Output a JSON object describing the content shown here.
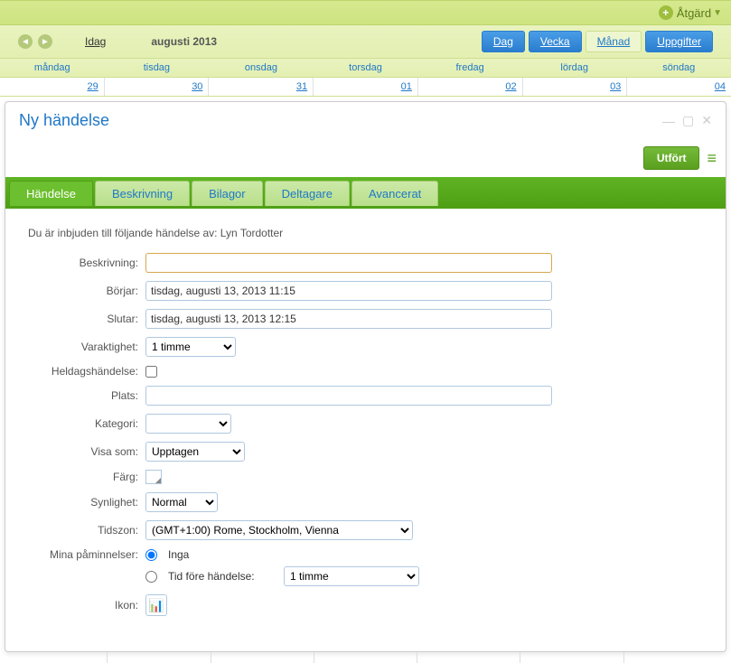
{
  "topbar": {
    "action_label": "Åtgärd"
  },
  "calendar": {
    "today_label": "Idag",
    "title": "augusti 2013",
    "views": {
      "day": "Dag",
      "week": "Vecka",
      "month": "Månad",
      "tasks": "Uppgifter"
    },
    "weekdays": [
      "måndag",
      "tisdag",
      "onsdag",
      "torsdag",
      "fredag",
      "lördag",
      "söndag"
    ],
    "daynums": [
      "29",
      "30",
      "31",
      "01",
      "02",
      "03",
      "04"
    ]
  },
  "dialog": {
    "title": "Ny händelse",
    "done_label": "Utfört",
    "tabs": {
      "event": "Händelse",
      "description": "Beskrivning",
      "attachments": "Bilagor",
      "participants": "Deltagare",
      "advanced": "Avancerat"
    },
    "invited_text": "Du är inbjuden till följande händelse av: Lyn Tordotter",
    "labels": {
      "description": "Beskrivning:",
      "starts": "Börjar:",
      "ends": "Slutar:",
      "duration": "Varaktighet:",
      "allday": "Heldagshändelse:",
      "location": "Plats:",
      "category": "Kategori:",
      "show_as": "Visa som:",
      "color": "Färg:",
      "visibility": "Synlighet:",
      "timezone": "Tidszon:",
      "reminders": "Mina påminnelser:",
      "icon": "Ikon:"
    },
    "values": {
      "description": "",
      "starts": "tisdag, augusti 13, 2013 11:15",
      "ends": "tisdag, augusti 13, 2013 12:15",
      "duration": "1 timme",
      "location": "",
      "category": "",
      "show_as": "Upptagen",
      "visibility": "Normal",
      "timezone": "(GMT+1:00) Rome, Stockholm, Vienna",
      "reminder_none": "Inga",
      "reminder_before": "Tid före händelse:",
      "reminder_time": "1 timme"
    }
  }
}
